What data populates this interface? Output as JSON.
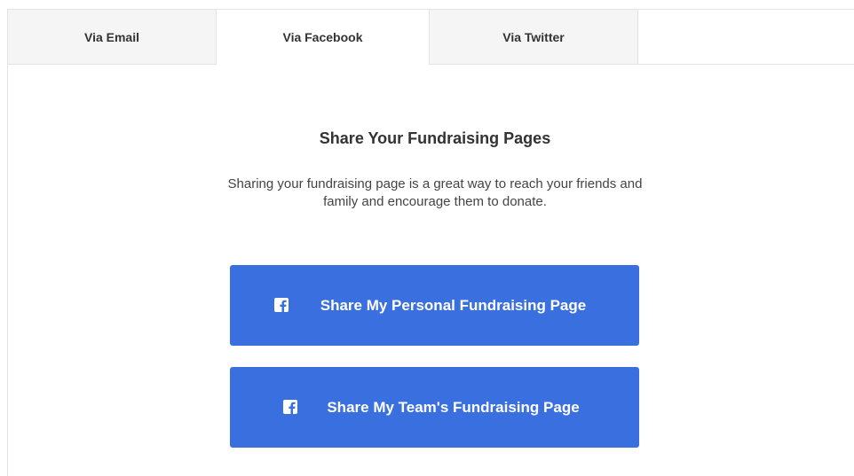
{
  "tabs": [
    {
      "label": "Via Email",
      "active": false
    },
    {
      "label": "Via Facebook",
      "active": true
    },
    {
      "label": "Via Twitter",
      "active": false
    }
  ],
  "panel": {
    "title": "Share Your Fundraising Pages",
    "description": "Sharing your fundraising page is a great way to reach your friends and family and encourage them to donate."
  },
  "buttons": {
    "personal_label": "Share My Personal Fundraising Page",
    "team_label": "Share My Team's Fundraising Page",
    "icon": "facebook-icon"
  },
  "colors": {
    "button_bg": "#3a6fe0",
    "button_text": "#ffffff",
    "tab_inactive_bg": "#f5f5f5",
    "border": "#e3e3e3",
    "text": "#333333"
  }
}
